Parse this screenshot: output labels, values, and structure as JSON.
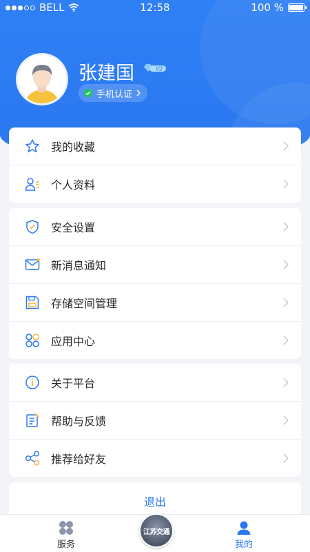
{
  "status_bar": {
    "carrier": "BELL",
    "time": "12:58",
    "battery": "100 %"
  },
  "profile": {
    "name": "张建国",
    "vip_level": "V2",
    "verify_label": "手机认证"
  },
  "groups": [
    {
      "items": [
        {
          "label": "我的收藏",
          "icon": "star-icon"
        },
        {
          "label": "个人资料",
          "icon": "profile-icon"
        }
      ]
    },
    {
      "items": [
        {
          "label": "安全设置",
          "icon": "shield-icon"
        },
        {
          "label": "新消息通知",
          "icon": "mail-icon"
        },
        {
          "label": "存储空间管理",
          "icon": "save-icon"
        },
        {
          "label": "应用中心",
          "icon": "apps-icon"
        }
      ]
    },
    {
      "items": [
        {
          "label": "关于平台",
          "icon": "info-icon"
        },
        {
          "label": "帮助与反馈",
          "icon": "feedback-icon"
        },
        {
          "label": "推荐给好友",
          "icon": "share-icon"
        }
      ]
    }
  ],
  "logout_label": "退出",
  "tabbar": {
    "services_label": "服务",
    "center_label": "江苏交通",
    "mine_label": "我的"
  },
  "colors": {
    "primary": "#2a78f0",
    "verify_green": "#21c35a",
    "page_bg": "#f2f4f7"
  }
}
